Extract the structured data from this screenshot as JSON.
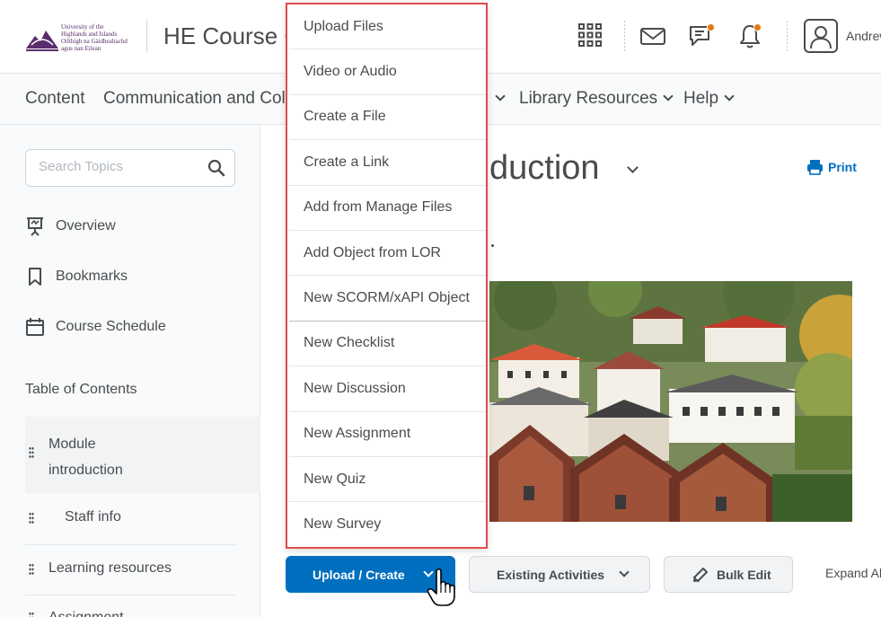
{
  "header": {
    "logo_lines": [
      "University of the",
      "Highlands and Islands",
      "Oilthigh na Gàidhealtachd",
      "agus nan Eilean"
    ],
    "course_title": "HE Course C",
    "user_name": "Andrew"
  },
  "navbar": {
    "items": [
      {
        "label": "Content"
      },
      {
        "label": "Communication and Coll"
      },
      {
        "label": "Library Resources"
      },
      {
        "label": "Help"
      }
    ]
  },
  "sidebar": {
    "search_placeholder": "Search Topics",
    "links": [
      {
        "label": "Overview",
        "icon": "presentation-icon"
      },
      {
        "label": "Bookmarks",
        "icon": "bookmark-icon"
      },
      {
        "label": "Course Schedule",
        "icon": "calendar-icon"
      }
    ],
    "toc_heading": "Table of Contents",
    "toc_items": [
      {
        "label_line1": "Module",
        "label_line2": "introduction",
        "active": true
      },
      {
        "label": "Staff info"
      },
      {
        "label": "Learning resources"
      },
      {
        "label": "Assignment"
      }
    ]
  },
  "main": {
    "heading_partial": "duction",
    "print_label": "Print"
  },
  "menu": {
    "items": [
      "Upload Files",
      "Video or Audio",
      "Create a File",
      "Create a Link",
      "Add from Manage Files",
      "Add Object from LOR",
      "New SCORM/xAPI Object",
      "New Checklist",
      "New Discussion",
      "New Assignment",
      "New Quiz",
      "New Survey"
    ]
  },
  "actions": {
    "upload_create": "Upload / Create",
    "existing_activities": "Existing Activities",
    "bulk_edit": "Bulk Edit",
    "expand_all": "Expand Al"
  },
  "colors": {
    "primary": "#006fbf",
    "notification": "#e87511",
    "menu_highlight_border": "#e34a4a",
    "logo_purple": "#5a2d6e"
  }
}
